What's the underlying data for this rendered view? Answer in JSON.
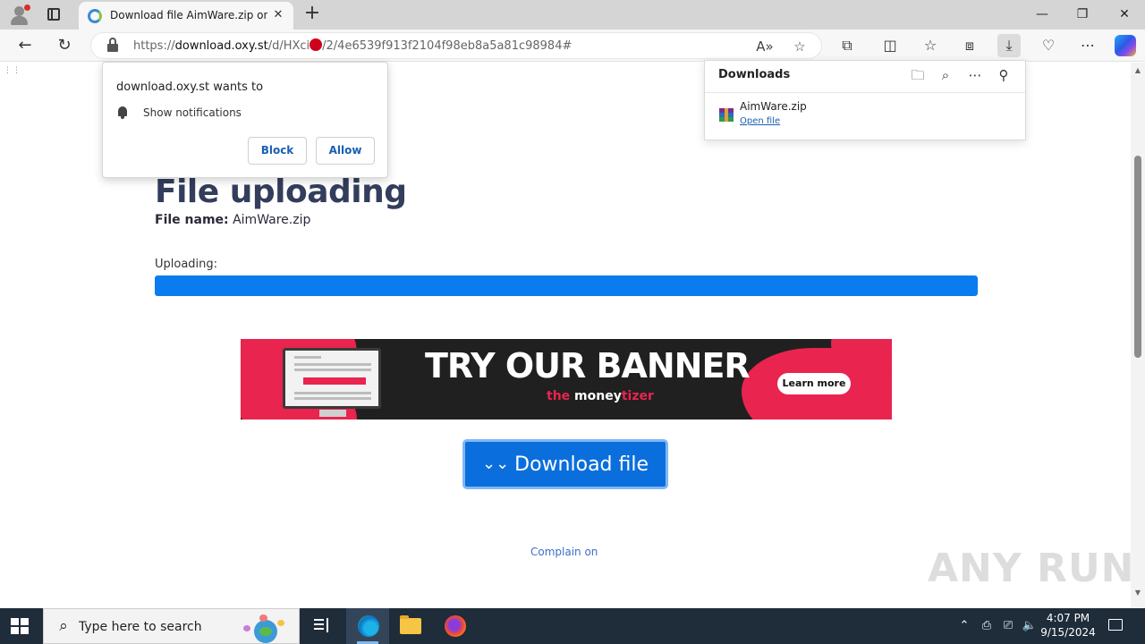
{
  "browser": {
    "tab": {
      "title": "Download file AimWare.zip on O"
    },
    "address": {
      "prefix": "https://",
      "host": "download.oxy.st",
      "path_a": "/d/HXci",
      "path_b": "/2/4e6539f913f2104f98eb8a5a81c98984#"
    }
  },
  "notification_prompt": {
    "title": "download.oxy.st wants to",
    "permission": "Show notifications",
    "block_label": "Block",
    "allow_label": "Allow"
  },
  "downloads_panel": {
    "title": "Downloads",
    "file_name": "AimWare.zip",
    "open_label": "Open file"
  },
  "page": {
    "heading": "File uploading",
    "file_label": "File name:",
    "file_value": "AimWare.zip",
    "uploading_label": "Uploading:",
    "progress_fraction": 1.0,
    "banner": {
      "title": "TRY OUR BANNER",
      "logo_a": "money",
      "logo_b": "tizer",
      "logo_top": "the",
      "cta": "Learn more"
    },
    "download_button": "Download file",
    "complain_link": "Complain on",
    "watermark": "ANY RUN"
  },
  "taskbar": {
    "search_placeholder": "Type here to search",
    "time": "4:07 PM",
    "date": "9/15/2024"
  },
  "colors": {
    "accent_blue": "#0a7cf0",
    "banner_pink": "#e8244f",
    "heading": "#333d5c"
  }
}
